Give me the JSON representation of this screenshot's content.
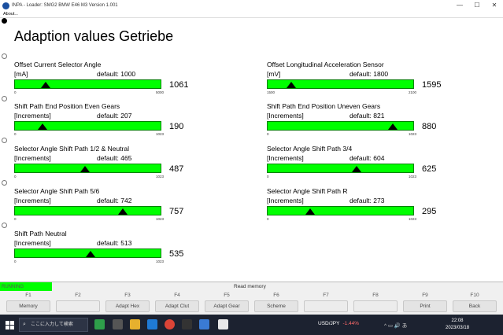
{
  "window": {
    "title": "INPA - Loader: SMG2 BMW E46 M3 Version 1.001",
    "minimize": "—",
    "maximize": "☐",
    "close": "✕"
  },
  "menu": {
    "about": "About..."
  },
  "page": {
    "title": "Adaption values Getriebe"
  },
  "gauges": [
    {
      "name": "Offset Current Selector Angle",
      "unit": "[mA]",
      "default_label": "default: 1000",
      "value": "1061",
      "min": "0",
      "max": "5000",
      "marker_fraction": 0.21
    },
    {
      "name": "Offset Longitudinal Acceleration Sensor",
      "unit": "[mV]",
      "default_label": "default: 1800",
      "value": "1595",
      "min": "1500",
      "max": "2100",
      "marker_fraction": 0.16
    },
    {
      "name": "Shift Path End Position Even Gears",
      "unit": "[Increments]",
      "default_label": "default: 207",
      "value": "190",
      "min": "0",
      "max": "1023",
      "marker_fraction": 0.19
    },
    {
      "name": "Shift Path End Position Uneven Gears",
      "unit": "[Increments]",
      "default_label": "default: 821",
      "value": "880",
      "min": "0",
      "max": "1023",
      "marker_fraction": 0.86
    },
    {
      "name": "Selector Angle Shift Path 1/2 & Neutral",
      "unit": "[Increments]",
      "default_label": "default: 465",
      "value": "487",
      "min": "0",
      "max": "1023",
      "marker_fraction": 0.48
    },
    {
      "name": "Selector Angle Shift Path 3/4",
      "unit": "[Increments]",
      "default_label": "default: 604",
      "value": "625",
      "min": "0",
      "max": "1023",
      "marker_fraction": 0.61
    },
    {
      "name": "Selector Angle Shift Path 5/6",
      "unit": "[Increments]",
      "default_label": "default: 742",
      "value": "757",
      "min": "0",
      "max": "1023",
      "marker_fraction": 0.74
    },
    {
      "name": "Selector Angle Shift Path R",
      "unit": "[Increments]",
      "default_label": "default: 273",
      "value": "295",
      "min": "0",
      "max": "1023",
      "marker_fraction": 0.29
    },
    {
      "name": "Shift Path Neutral",
      "unit": "[Increments]",
      "default_label": "default: 513",
      "value": "535",
      "min": "0",
      "max": "1023",
      "marker_fraction": 0.52
    }
  ],
  "status": {
    "running": "RUNNING",
    "message": "Read memory"
  },
  "fkeys": [
    {
      "key": "F1",
      "label": "Memory"
    },
    {
      "key": "F2",
      "label": ""
    },
    {
      "key": "F3",
      "label": "Adapt Hex"
    },
    {
      "key": "F4",
      "label": "Adapt Clut"
    },
    {
      "key": "F5",
      "label": "Adapt Gear"
    },
    {
      "key": "F6",
      "label": "Scheme"
    },
    {
      "key": "F7",
      "label": ""
    },
    {
      "key": "F8",
      "label": ""
    },
    {
      "key": "F9",
      "label": "Print"
    },
    {
      "key": "F10",
      "label": "Back"
    }
  ],
  "taskbar": {
    "search_placeholder": "ここに入力して検索",
    "ticker_symbol": "USD/JPY",
    "ticker_change": "-1.44%",
    "tray_text": "^ ▭ 🔊 あ",
    "time": "22:08",
    "date": "2023/03/18"
  },
  "colors": {
    "bar": "#00ff00",
    "running": "#00ff00",
    "taskbar": "#1c2230"
  }
}
